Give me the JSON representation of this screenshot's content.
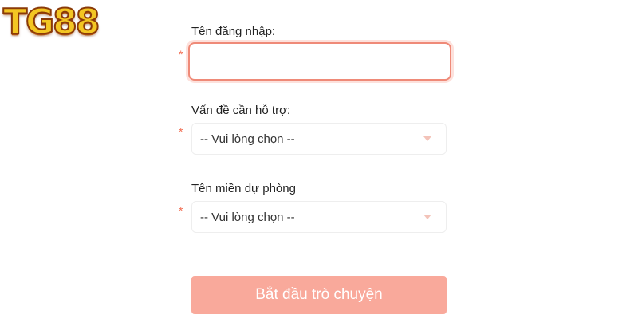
{
  "brand": {
    "logo_prefix": "TG",
    "logo_suffix": "88",
    "logo_text": "TG88"
  },
  "form": {
    "username": {
      "label": "Tên đăng nhập:",
      "required_mark": "*",
      "value": "",
      "placeholder": ""
    },
    "issue": {
      "label": "Vấn đề cần hỗ trợ:",
      "required_mark": "*",
      "selected": "-- Vui lòng chọn --"
    },
    "backup_domain": {
      "label": "Tên miền dự phòng",
      "required_mark": "*",
      "selected": "-- Vui lòng chọn --"
    },
    "submit_label": "Bắt đầu trò chuyện"
  },
  "colors": {
    "accent": "#f9a99b",
    "focus_border": "#ef8a78",
    "required": "#f26b4f",
    "logo_gold": "#f3c623"
  }
}
